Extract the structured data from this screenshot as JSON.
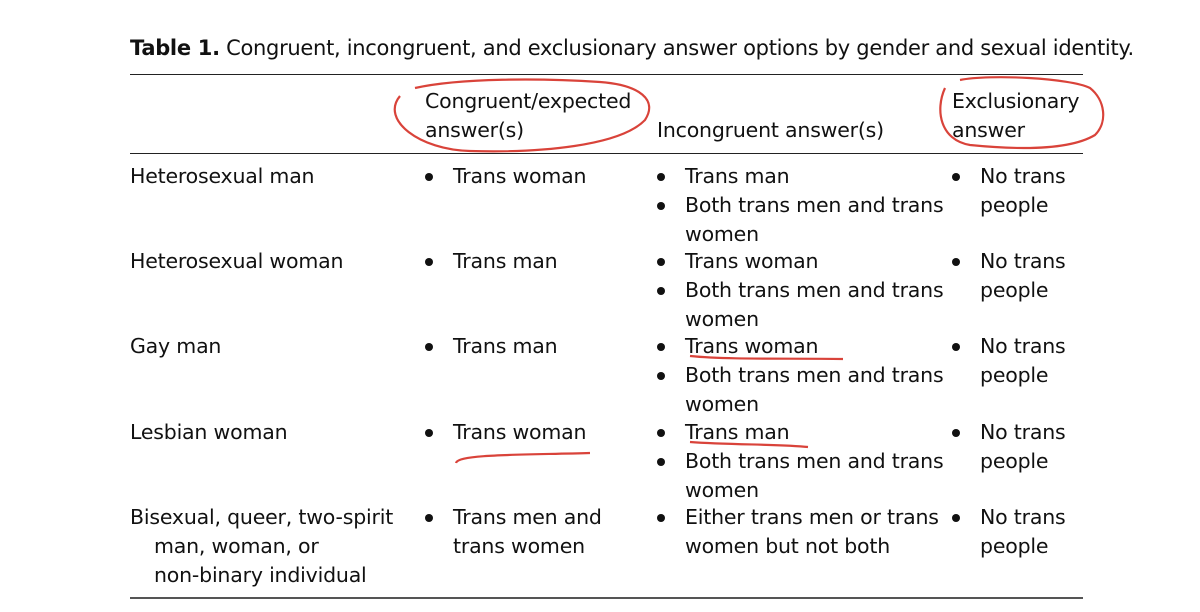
{
  "caption": {
    "label": "Table 1.",
    "text": " Congruent, incongruent, and exclusionary answer options by gender and sexual identity."
  },
  "headers": {
    "identity": "",
    "congruent_line1": "Congruent/expected",
    "congruent_line2": "answer(s)",
    "incongruent": "Incongruent answer(s)",
    "exclusionary_line1": "Exclusionary",
    "exclusionary_line2": "answer"
  },
  "rows": [
    {
      "identity": [
        "Heterosexual man"
      ],
      "congruent": [
        [
          "Trans woman"
        ]
      ],
      "incongruent": [
        [
          "Trans man"
        ],
        [
          "Both trans men and trans",
          "women"
        ]
      ],
      "exclusionary": [
        [
          "No trans",
          "people"
        ]
      ]
    },
    {
      "identity": [
        "Heterosexual woman"
      ],
      "congruent": [
        [
          "Trans man"
        ]
      ],
      "incongruent": [
        [
          "Trans woman"
        ],
        [
          "Both trans men and trans",
          "women"
        ]
      ],
      "exclusionary": [
        [
          "No trans",
          "people"
        ]
      ]
    },
    {
      "identity": [
        "Gay man"
      ],
      "congruent": [
        [
          "Trans man"
        ]
      ],
      "incongruent": [
        [
          "Trans woman"
        ],
        [
          "Both trans men and trans",
          "women"
        ]
      ],
      "exclusionary": [
        [
          "No trans",
          "people"
        ]
      ]
    },
    {
      "identity": [
        "Lesbian woman"
      ],
      "congruent": [
        [
          "Trans woman"
        ]
      ],
      "incongruent": [
        [
          "Trans man"
        ],
        [
          "Both trans men and trans",
          "women"
        ]
      ],
      "exclusionary": [
        [
          "No trans",
          "people"
        ]
      ]
    },
    {
      "identity": [
        "Bisexual, queer, two-spirit",
        "man, woman, or",
        "non-binary individual"
      ],
      "congruent": [
        [
          "Trans men and",
          "trans women"
        ]
      ],
      "incongruent": [
        [
          "Either trans men or trans",
          "women but not both"
        ]
      ],
      "exclusionary": [
        [
          "No trans",
          "people"
        ]
      ]
    }
  ],
  "annotations": {
    "color": "#d9433a",
    "circled_headers": [
      "Congruent/expected answer(s)",
      "Exclusionary answer"
    ],
    "underlined_items": [
      "Gay man: Trans woman (incongruent)",
      "Lesbian woman: Trans woman (congruent)",
      "Lesbian woman: Trans man (incongruent)"
    ]
  }
}
